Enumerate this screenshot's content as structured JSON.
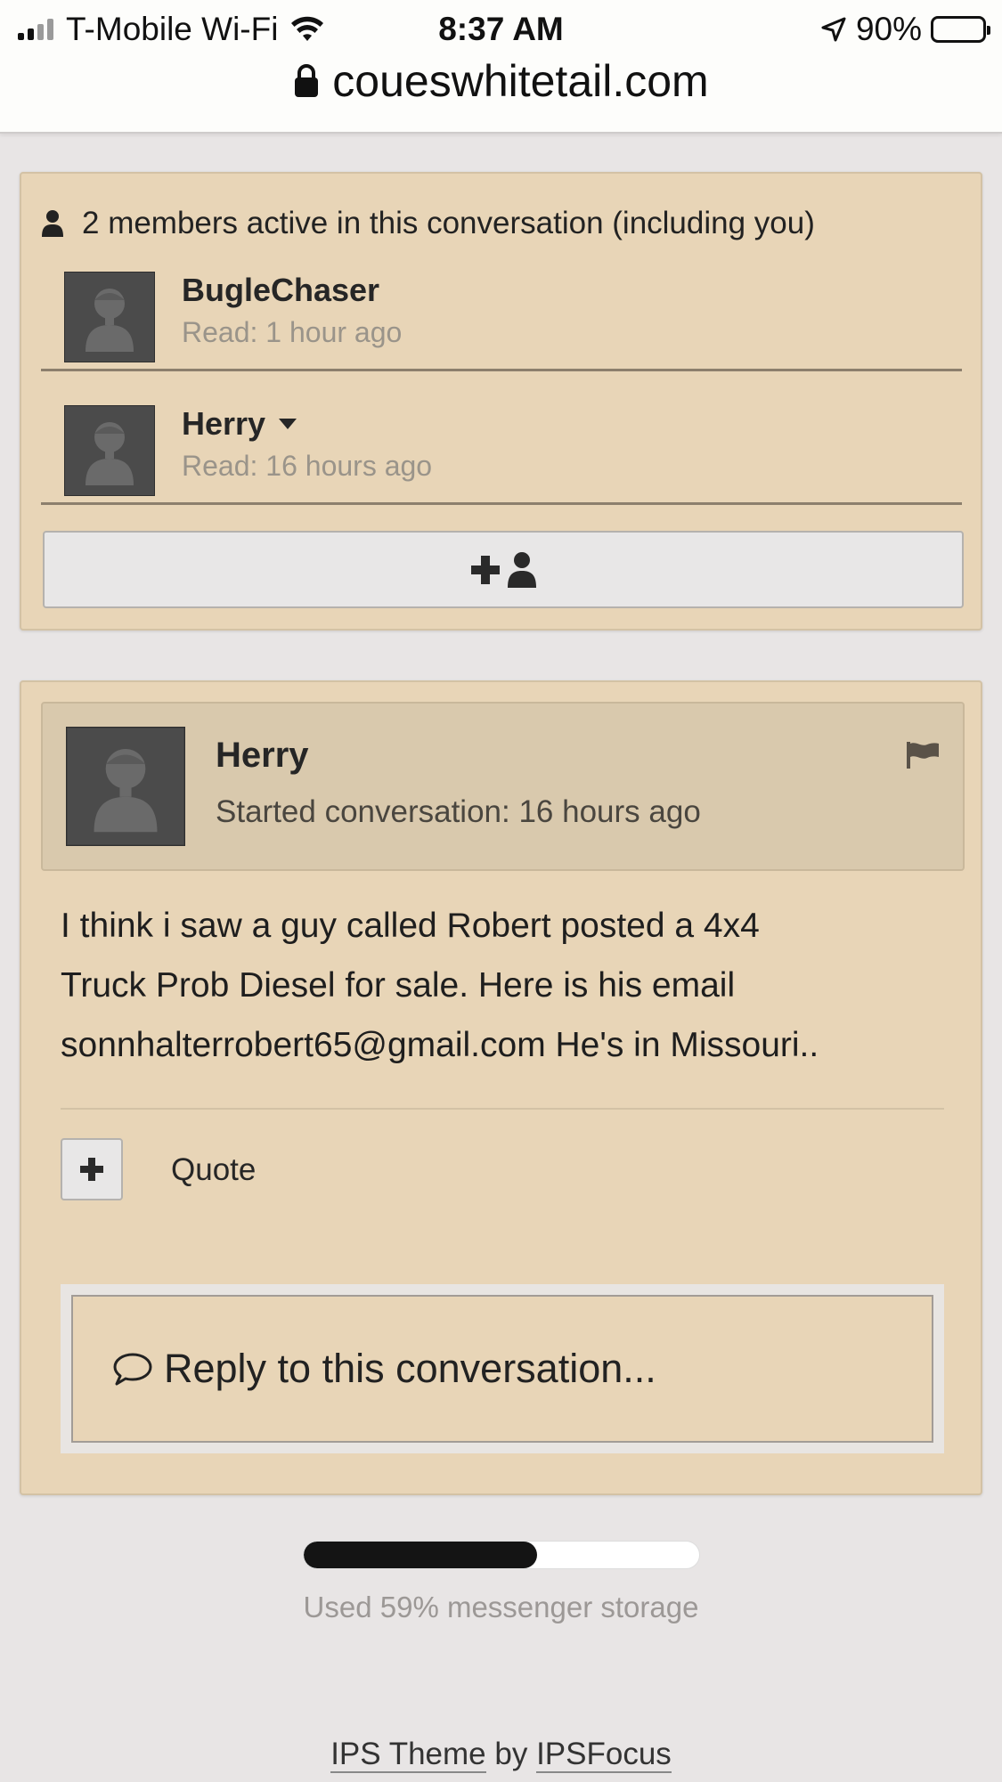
{
  "status_bar": {
    "carrier": "T-Mobile Wi-Fi",
    "time": "8:37 AM",
    "battery_percent": "90%",
    "battery_level": 0.9
  },
  "browser": {
    "url": "coueswhitetail.com"
  },
  "members_panel": {
    "heading": "2 members active in this conversation (including you)",
    "members": [
      {
        "name": "BugleChaser",
        "read": "Read: 1 hour ago",
        "has_menu": false
      },
      {
        "name": "Herry",
        "read": "Read: 16 hours ago",
        "has_menu": true
      }
    ],
    "add_member_icon": "add-user-icon"
  },
  "conversation": {
    "author": "Herry",
    "meta": "Started conversation: 16 hours ago",
    "body_lines": [
      "I think i saw a guy called Robert posted a 4x4",
      "Truck Prob Diesel for sale. Here is his email",
      "sonnhalterrobert65@gmail.com He's in Missouri.."
    ],
    "quote_label": "Quote",
    "reply_placeholder": "Reply to this conversation..."
  },
  "storage": {
    "used_fraction": 0.59,
    "label": "Used 59% messenger storage"
  },
  "footer": {
    "theme_link": "IPS Theme",
    "by": "by",
    "author_link": "IPSFocus"
  },
  "colors": {
    "panel_bg": "#e8d5b7",
    "page_bg": "#e8e5e5",
    "avatar_bg": "#4b4b4b"
  }
}
